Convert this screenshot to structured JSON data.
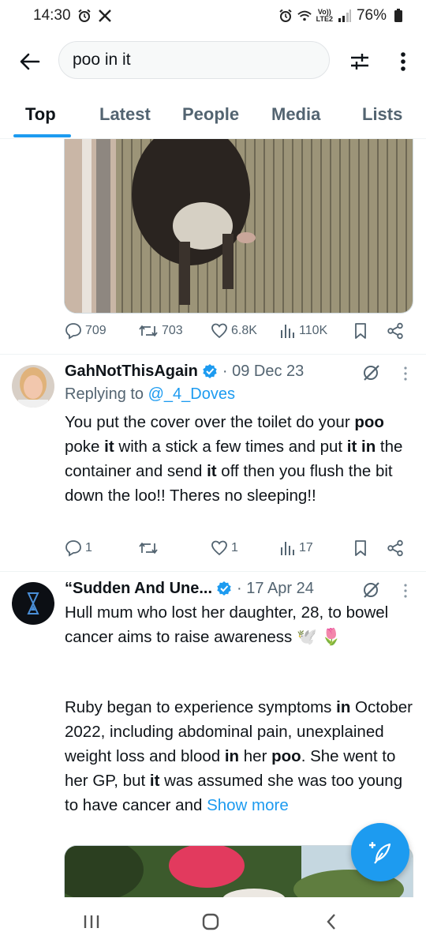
{
  "status_bar": {
    "time": "14:30",
    "network_top": "Vo))",
    "network_bottom": "LTE2",
    "battery": "76%"
  },
  "search": {
    "query": "poo in it"
  },
  "tabs": [
    {
      "label": "Top",
      "active": true
    },
    {
      "label": "Latest",
      "active": false
    },
    {
      "label": "People",
      "active": false
    },
    {
      "label": "Media",
      "active": false
    },
    {
      "label": "Lists",
      "active": false
    }
  ],
  "tweets": [
    {
      "actions": {
        "replies": "709",
        "retweets": "703",
        "likes": "6.8K",
        "views": "110K"
      }
    },
    {
      "name": "GahNotThisAgain",
      "date": "· 09 Dec 23",
      "replying_prefix": "Replying to ",
      "replying_handle": "@_4_Doves",
      "text_html": "You put the cover over the toilet do your <b>poo</b> poke <b>it</b> with a stick a few times and put <b>it in</b> the container and send <b>it</b> off then you flush the bit down the loo!! Theres no sleeping!!",
      "actions": {
        "replies": "1",
        "retweets": "",
        "likes": "1",
        "views": "17"
      }
    },
    {
      "name": "“Sudden And Une...",
      "date": "· 17 Apr 24",
      "text_line1": "Hull mum who lost her daughter, 28, to bowel cancer aims to raise awareness 🕊️ 🌷",
      "text_html": "Ruby began to experience symptoms <b>in</b> October 2022, including abdominal pain, unexplained weight loss and blood <b>in</b> her <b>poo</b>. She went to her GP, but <b>it</b> was assumed she was too young to have cancer and ",
      "show_more": "Show more"
    }
  ],
  "colors": {
    "accent": "#1d9bf0",
    "text": "#0f1419",
    "secondary": "#536471"
  }
}
